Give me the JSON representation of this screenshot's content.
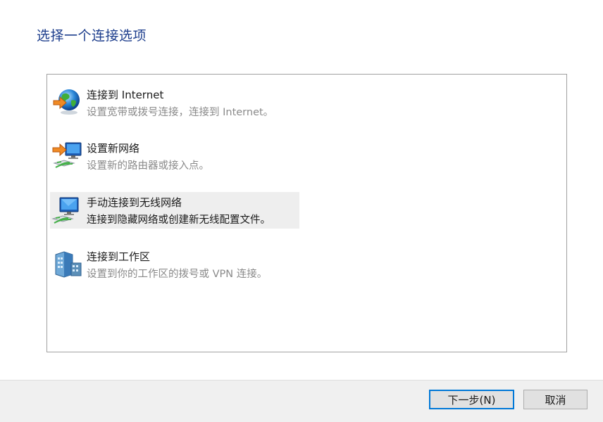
{
  "heading": "选择一个连接选项",
  "options": [
    {
      "icon": "globe-internet-icon",
      "title": "连接到 Internet",
      "description": "设置宽带或拨号连接，连接到 Internet。",
      "selected": false
    },
    {
      "icon": "new-network-setup-icon",
      "title": "设置新网络",
      "description": "设置新的路由器或接入点。",
      "selected": false
    },
    {
      "icon": "wireless-network-icon",
      "title": "手动连接到无线网络",
      "description": "连接到隐藏网络或创建新无线配置文件。",
      "selected": true
    },
    {
      "icon": "workplace-vpn-icon",
      "title": "连接到工作区",
      "description": "设置到你的工作区的拨号或 VPN 连接。",
      "selected": false
    }
  ],
  "buttons": {
    "next_label": "下一步(N)",
    "cancel_label": "取消"
  },
  "colors": {
    "heading": "#1c3d8c",
    "selection_bg": "#eeeeee",
    "primary_button_border": "#0078d7",
    "footer_bg": "#f0f0f0"
  }
}
